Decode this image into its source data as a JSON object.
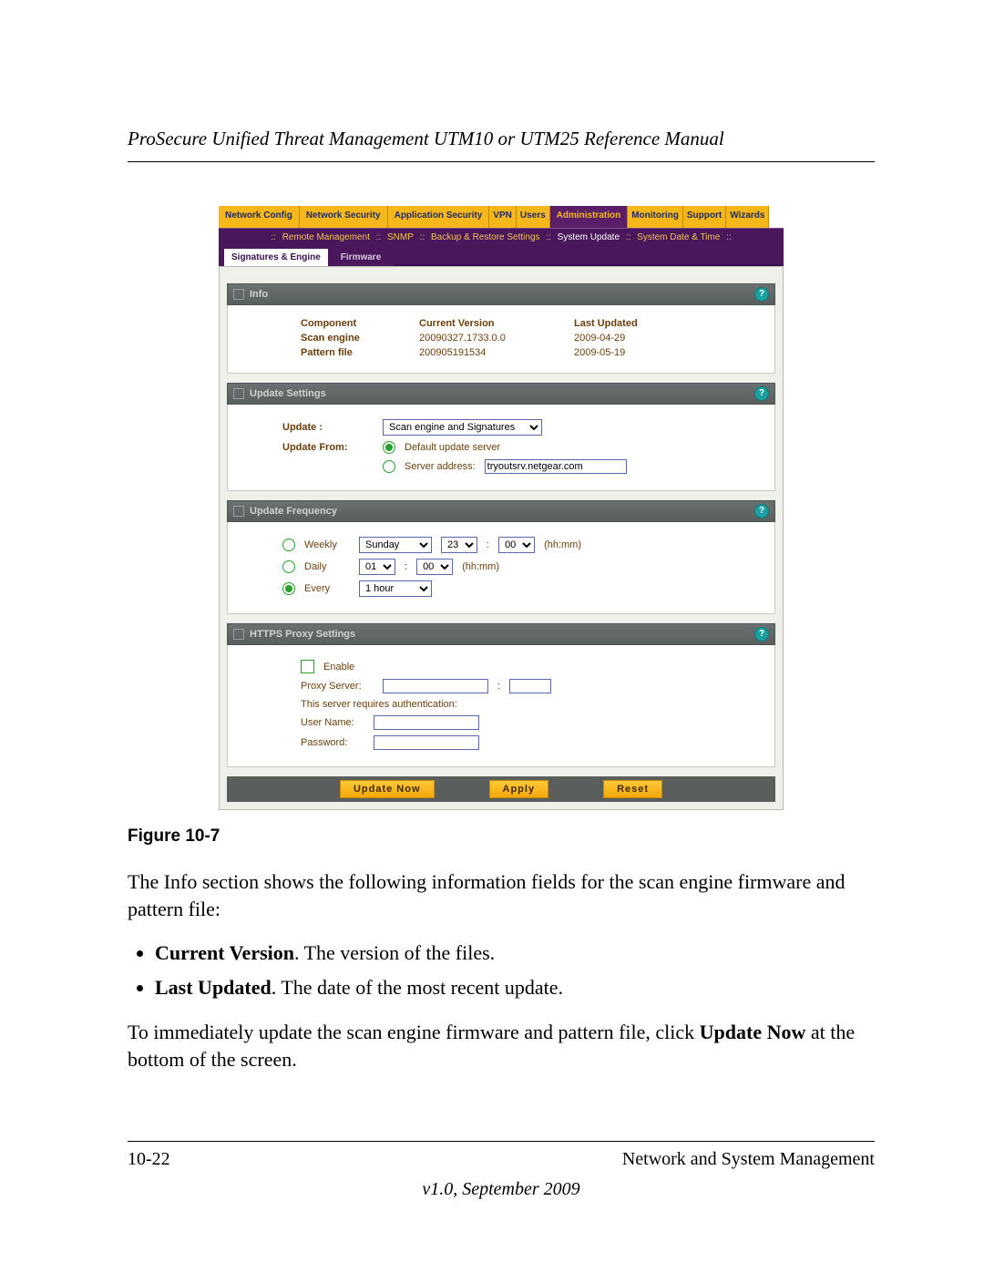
{
  "doc": {
    "running_header": "ProSecure Unified Threat Management UTM10 or UTM25 Reference Manual",
    "figure_caption": "Figure 10-7",
    "para1": "The Info section shows the following information fields for the scan engine firmware and pattern file:",
    "bullets": [
      {
        "term": "Current Version",
        "rest": ". The version of the files."
      },
      {
        "term": "Last Updated",
        "rest": ". The date of the most recent update."
      }
    ],
    "para2_a": "To immediately update the scan engine firmware and pattern file, click ",
    "para2_b": "Update Now",
    "para2_c": " at the bottom of the screen.",
    "footer_left": "10-22",
    "footer_right": "Network and System Management",
    "footer_version": "v1.0, September 2009"
  },
  "ui": {
    "nav1": [
      "Network Config",
      "Network Security",
      "Application Security",
      "VPN",
      "Users",
      "Administration",
      "Monitoring",
      "Support",
      "Wizards"
    ],
    "nav1_active": "Administration",
    "subnav": {
      "items": [
        "Remote Management",
        "SNMP",
        "Backup & Restore Settings",
        "System Update",
        "System Date & Time"
      ],
      "active": "System Update"
    },
    "tabs2": {
      "active": "Signatures & Engine",
      "other": "Firmware"
    },
    "info": {
      "title": "Info",
      "headers": [
        "Component",
        "Current Version",
        "Last Updated"
      ],
      "rows": [
        [
          "Scan engine",
          "20090327.1733.0.0",
          "2009-04-29"
        ],
        [
          "Pattern file",
          "200905191534",
          "2009-05-19"
        ]
      ]
    },
    "update": {
      "title": "Update Settings",
      "label_update": "Update :",
      "update_select": "Scan engine and Signatures",
      "label_from": "Update From:",
      "opt_default": "Default update server",
      "opt_server": "Server address:",
      "server_value": "tryoutsrv.netgear.com"
    },
    "freq": {
      "title": "Update Frequency",
      "weekly": "Weekly",
      "daily": "Daily",
      "every": "Every",
      "weekly_day": "Sunday",
      "weekly_hh": "23",
      "weekly_mm": "00",
      "daily_hh": "01",
      "daily_mm": "00",
      "every_val": "1 hour",
      "hhmm": "(hh:mm)"
    },
    "proxy": {
      "title": "HTTPS Proxy Settings",
      "enable": "Enable",
      "proxy_server": "Proxy Server:",
      "colon": ":",
      "auth": "This server requires authentication:",
      "user": "User Name:",
      "pass": "Password:"
    },
    "buttons": {
      "update_now": "Update Now",
      "apply": "Apply",
      "reset": "Reset"
    }
  }
}
